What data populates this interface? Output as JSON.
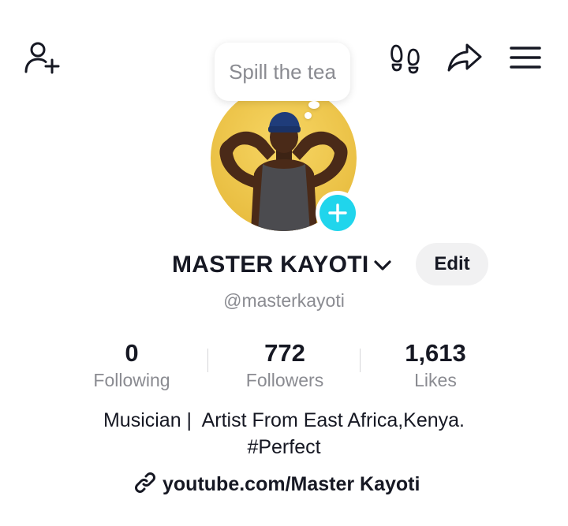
{
  "top_bar": {
    "add_friend_icon": "person-add-icon",
    "footprint_icon": "footprints-icon",
    "share_icon": "share-arrow-icon",
    "menu_icon": "hamburger-menu-icon"
  },
  "note_bubble": {
    "placeholder": "Spill the tea"
  },
  "profile": {
    "display_name": "MASTER KAYOTI",
    "username": "@masterkayoti",
    "edit_label": "Edit",
    "avatar_accent": "#f3c842",
    "add_button_color": "#20d5ec"
  },
  "stats": [
    {
      "value": "0",
      "label": "Following"
    },
    {
      "value": "772",
      "label": "Followers"
    },
    {
      "value": "1,613",
      "label": "Likes"
    }
  ],
  "bio": {
    "line1": "Musician |  Artist From East Africa,Kenya.",
    "line2": "#Perfect"
  },
  "link": {
    "icon": "link-icon",
    "text": "youtube.com/Master Kayoti"
  }
}
